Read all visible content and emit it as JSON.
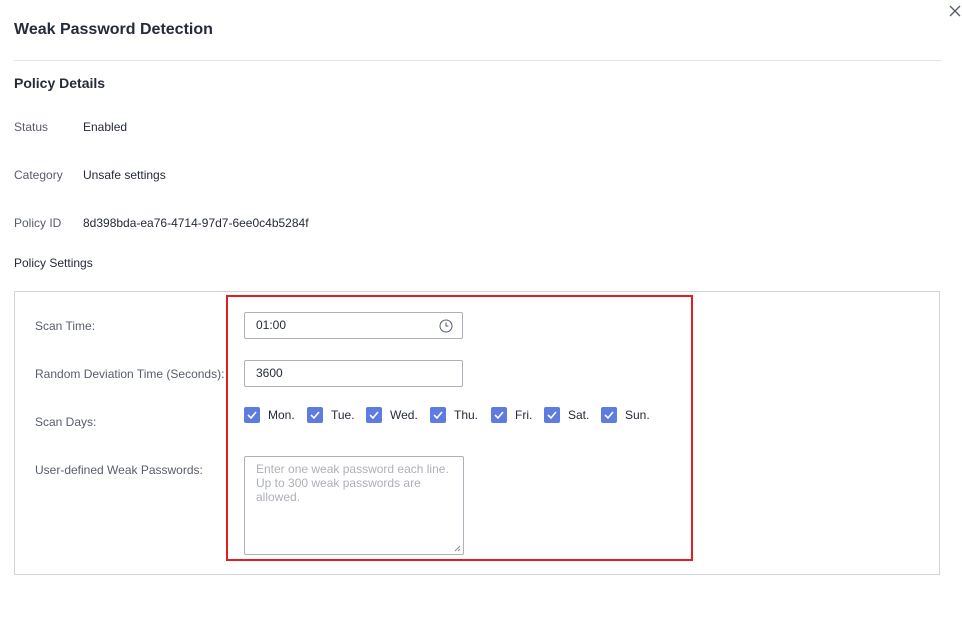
{
  "dialog": {
    "title": "Weak Password Detection",
    "close_icon": "close-icon"
  },
  "policy_details": {
    "section_title": "Policy Details",
    "status": {
      "label": "Status",
      "value": "Enabled"
    },
    "category": {
      "label": "Category",
      "value": "Unsafe settings"
    },
    "policy_id": {
      "label": "Policy ID",
      "value": "8d398bda-ea76-4714-97d7-6ee0c4b5284f"
    }
  },
  "policy_settings": {
    "section_title": "Policy Settings",
    "scan_time": {
      "label": "Scan Time:",
      "value": "01:00",
      "icon": "clock-icon"
    },
    "random_deviation": {
      "label": "Random Deviation Time (Seconds):",
      "value": "3600"
    },
    "scan_days": {
      "label": "Scan Days:",
      "days": [
        {
          "label": "Mon.",
          "checked": true
        },
        {
          "label": "Tue.",
          "checked": true
        },
        {
          "label": "Wed.",
          "checked": true
        },
        {
          "label": "Thu.",
          "checked": true
        },
        {
          "label": "Fri.",
          "checked": true
        },
        {
          "label": "Sat.",
          "checked": true
        },
        {
          "label": "Sun.",
          "checked": true
        }
      ]
    },
    "weak_passwords": {
      "label": "User-defined Weak Passwords:",
      "placeholder": "Enter one weak password each line. Up to 300 weak passwords are allowed."
    }
  },
  "colors": {
    "accent": "#5e7ce0",
    "highlight": "#e02020",
    "border": "#adb0b8"
  }
}
